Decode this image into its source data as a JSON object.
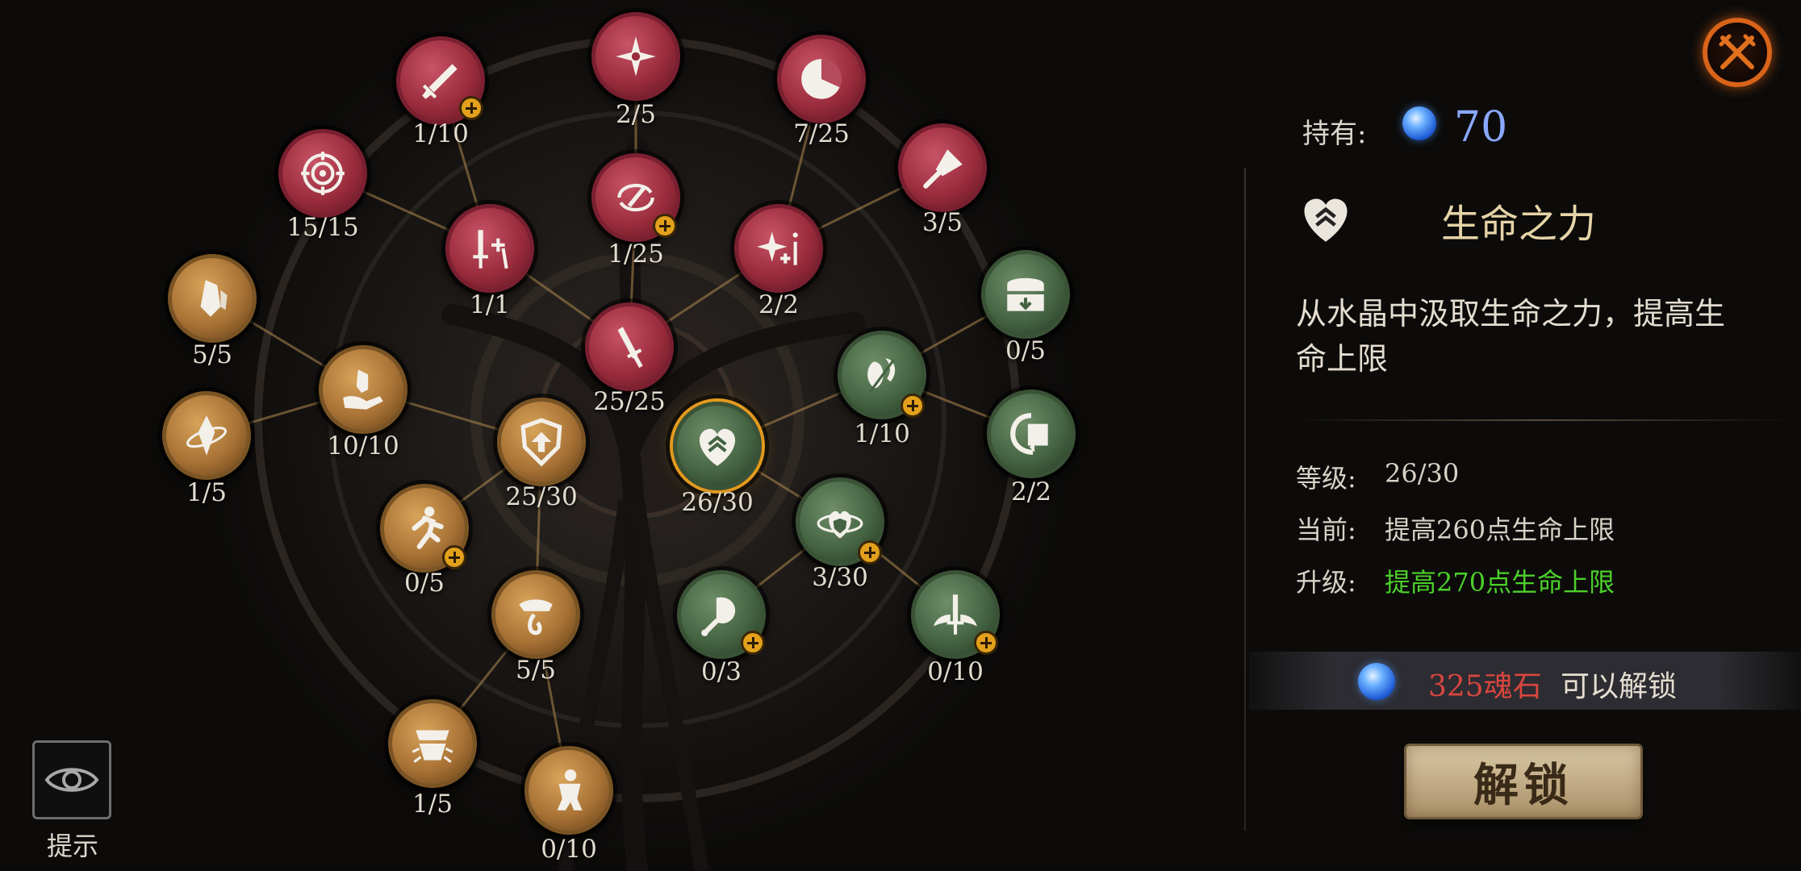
{
  "colors": {
    "accent_level": "#e39a1e",
    "value_green": "#4cd02a",
    "cost_red": "#d8463e",
    "gem_blue": "#2f7bf0",
    "close_orange": "#d8631a"
  },
  "hint": {
    "label": "提示",
    "icon": "eye-icon"
  },
  "close": {
    "icon": "crossed-swords-icon"
  },
  "currency": {
    "label": "持有:",
    "icon": "soul-stone-icon",
    "amount": "70"
  },
  "skill": {
    "icon": "heart-chevrons-icon",
    "name": "生命之力",
    "description_line1": "从水晶中汲取生命之力，提高生",
    "description_line2": "命上限",
    "level_label": "等级:",
    "level_value": "26/30",
    "current_label": "当前:",
    "current_value": "提高260点生命上限",
    "upgrade_label": "升级:",
    "upgrade_value": "提高270点生命上限"
  },
  "cost": {
    "icon": "soul-stone-icon",
    "amount": "325魂石",
    "status": "可以解锁"
  },
  "unlock_button": {
    "label": "解锁"
  },
  "nodes": [
    {
      "id": "n-sword-down",
      "icon": "sword-strike-icon",
      "color": "red",
      "level": "1/10",
      "plus": true
    },
    {
      "id": "n-shuriken",
      "icon": "shuriken-burst-icon",
      "color": "red",
      "level": "2/5",
      "plus": false
    },
    {
      "id": "n-clock",
      "icon": "cooldown-clock-icon",
      "color": "red",
      "level": "7/25",
      "plus": false
    },
    {
      "id": "n-target",
      "icon": "target-icon",
      "color": "red",
      "level": "15/15",
      "plus": false
    },
    {
      "id": "n-swirl",
      "icon": "spin-slash-icon",
      "color": "red",
      "level": "1/25",
      "plus": true
    },
    {
      "id": "n-cleaver",
      "icon": "cleaver-icon",
      "color": "red",
      "level": "3/5",
      "plus": false
    },
    {
      "id": "n-double-sword",
      "icon": "sword-plus-icon",
      "color": "red",
      "level": "1/1",
      "plus": false
    },
    {
      "id": "n-shuriken-plus",
      "icon": "shuriken-plus-icon",
      "color": "red",
      "level": "2/2",
      "plus": false
    },
    {
      "id": "n-sword-base",
      "icon": "sword-icon",
      "color": "red",
      "level": "25/25",
      "plus": false
    },
    {
      "id": "n-crystal-a",
      "icon": "crystal-icon",
      "color": "gold",
      "level": "5/5",
      "plus": false
    },
    {
      "id": "n-crystal-hand",
      "icon": "crystal-hand-icon",
      "color": "gold",
      "level": "10/10",
      "plus": false
    },
    {
      "id": "n-crystal-orbit",
      "icon": "crystal-orbit-icon",
      "color": "gold",
      "level": "1/5",
      "plus": false
    },
    {
      "id": "n-shield-up",
      "icon": "shield-arrow-icon",
      "color": "gold",
      "level": "25/30",
      "plus": false
    },
    {
      "id": "n-runner",
      "icon": "runner-icon",
      "color": "gold",
      "level": "0/5",
      "plus": true
    },
    {
      "id": "n-hand-drop",
      "icon": "hand-drop-icon",
      "color": "gold",
      "level": "5/5",
      "plus": false
    },
    {
      "id": "n-chest-open",
      "icon": "chest-burst-icon",
      "color": "gold",
      "level": "1/5",
      "plus": false
    },
    {
      "id": "n-figure",
      "icon": "warrior-figure-icon",
      "color": "gold",
      "level": "0/10",
      "plus": false
    },
    {
      "id": "n-heart",
      "icon": "heart-chevrons-icon",
      "color": "green",
      "level": "26/30",
      "plus": false,
      "selected": true
    },
    {
      "id": "n-shield-slash",
      "icon": "shield-slash-icon",
      "color": "green",
      "level": "1/10",
      "plus": true
    },
    {
      "id": "n-chest",
      "icon": "chest-icon",
      "color": "green",
      "level": "0/5",
      "plus": false
    },
    {
      "id": "n-refresh",
      "icon": "rotate-shield-icon",
      "color": "green",
      "level": "2/2",
      "plus": false
    },
    {
      "id": "n-heart-shield",
      "icon": "heart-shield-icon",
      "color": "green",
      "level": "3/30",
      "plus": true
    },
    {
      "id": "n-meat",
      "icon": "drumstick-icon",
      "color": "green",
      "level": "0/3",
      "plus": true
    },
    {
      "id": "n-wing-sword",
      "icon": "winged-sword-icon",
      "color": "green",
      "level": "0/10",
      "plus": true
    }
  ]
}
